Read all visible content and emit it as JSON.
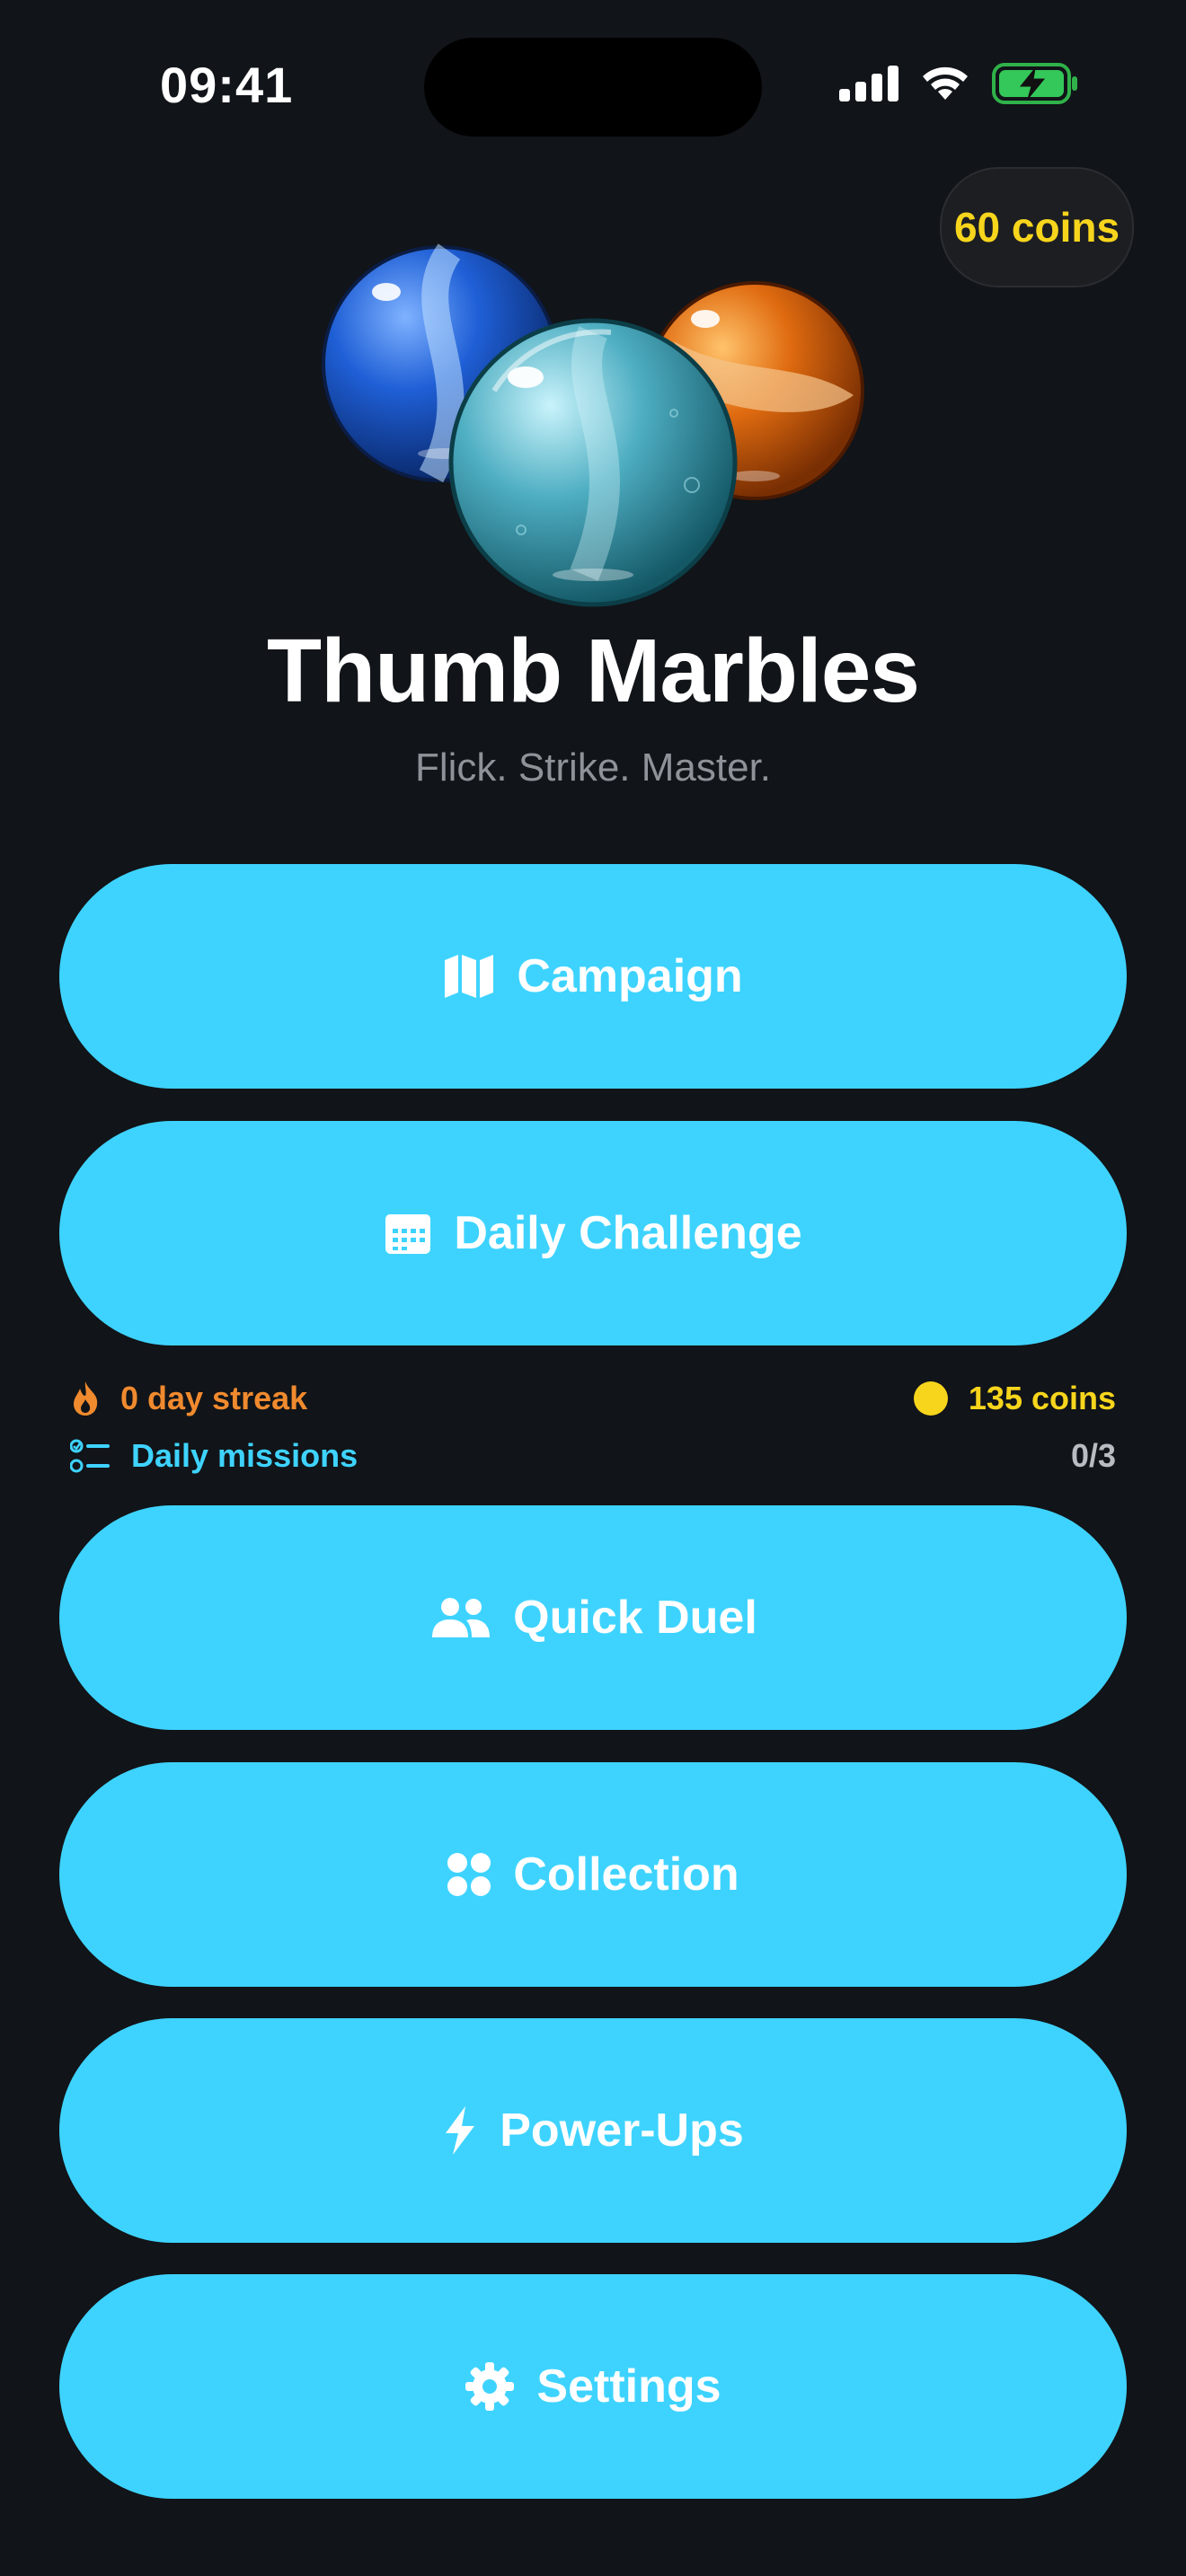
{
  "status_bar": {
    "time": "09:41"
  },
  "wallet": {
    "coins_label": "60 coins"
  },
  "hero": {
    "title": "Thumb Marbles",
    "subtitle": "Flick. Strike. Master."
  },
  "menu": {
    "campaign": {
      "label": "Campaign",
      "icon": "map-icon"
    },
    "daily_challenge": {
      "label": "Daily Challenge",
      "icon": "calendar-icon"
    },
    "quick_duel": {
      "label": "Quick Duel",
      "icon": "people-icon"
    },
    "collection": {
      "label": "Collection",
      "icon": "grid-dots-icon"
    },
    "power_ups": {
      "label": "Power-Ups",
      "icon": "bolt-icon"
    },
    "settings": {
      "label": "Settings",
      "icon": "gear-icon"
    }
  },
  "daily": {
    "streak_label": "0 day streak",
    "reward_label": "135 coins",
    "missions_label": "Daily missions",
    "missions_progress": "0/3"
  },
  "colors": {
    "background": "#111418",
    "button": "#3ed3ff",
    "coin_yellow": "#f7d51c",
    "streak_orange": "#f08a2e"
  }
}
